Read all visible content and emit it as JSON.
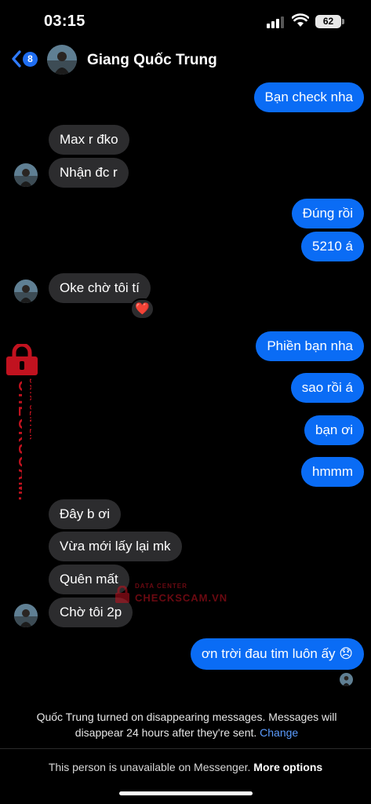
{
  "status_bar": {
    "time": "03:15",
    "battery": "62"
  },
  "header": {
    "back_count": "8",
    "contact_name": "Giang Quốc Trung"
  },
  "messages": {
    "m1": "Bạn check nha",
    "m2": "Max r đko",
    "m3": "Nhận đc r",
    "m4": "Đúng rồi",
    "m5": "5210 á",
    "m6": "Oke chờ tôi tí",
    "m7": "Phiền bạn nha",
    "m8": "sao rồi á",
    "m9": "bạn ơi",
    "m10": "hmmm",
    "m11": "Đây b ơi",
    "m12": "Vừa mới lấy lại mk",
    "m13": "Quên mất",
    "m14": "Chờ tôi 2p",
    "m15": "ơn trời đau tim luôn ấy 😞"
  },
  "reaction": {
    "emoji": "❤️"
  },
  "system_note": {
    "text": "Quốc Trung turned on disappearing messages. Messages will disappear 24 hours after they're sent.",
    "link": "Change"
  },
  "footer": {
    "text": "This person is unavailable on Messenger.",
    "link": "More options"
  },
  "watermark": {
    "brand": "CHECKSCAM.VN",
    "sub": "DATA CENTER",
    "color": "#c1121f"
  },
  "colors": {
    "outgoing": "#0a6cf5",
    "incoming": "#2c2c2e",
    "link": "#5b9cff"
  }
}
